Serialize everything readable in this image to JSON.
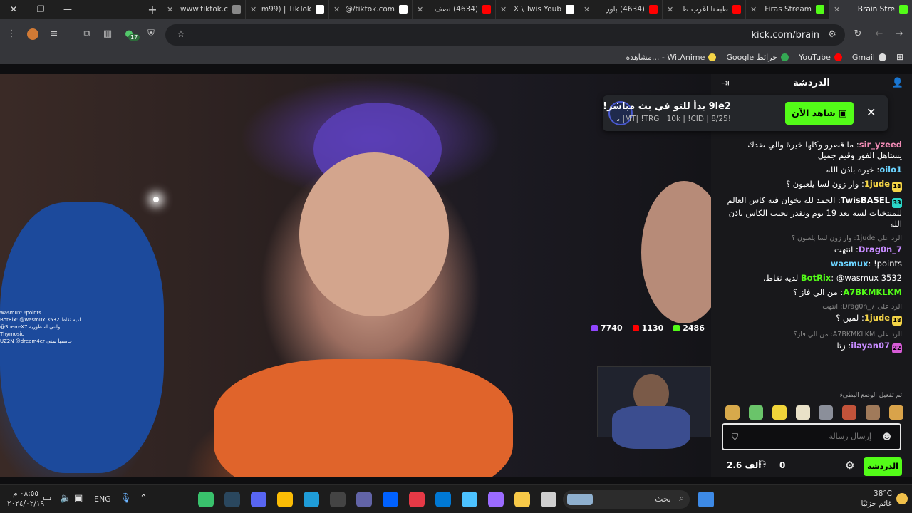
{
  "tabs": [
    {
      "title": "Brain Stre",
      "active": true,
      "favicon_color": "#53fc18"
    },
    {
      "title": "Firas Stream",
      "active": false,
      "favicon_color": "#53fc18"
    },
    {
      "title": "طبخنا اغرب ط",
      "active": false,
      "favicon_color": "#ff0000"
    },
    {
      "title": "(4634) باور",
      "active": false,
      "favicon_color": "#ff0000"
    },
    {
      "title": "X \\ Twis Youb",
      "active": false,
      "favicon_color": "#ffffff"
    },
    {
      "title": "(4634) نصف",
      "active": false,
      "favicon_color": "#ff0000"
    },
    {
      "title": "tiktok.com/@",
      "active": false,
      "favicon_color": "#ffffff"
    },
    {
      "title": "m99) | TikTok",
      "active": false,
      "favicon_color": "#ffffff"
    },
    {
      "title": "www.tiktok.c",
      "active": false,
      "favicon_color": "#888888"
    }
  ],
  "address": {
    "url": "kick.com/brain"
  },
  "extensions": {
    "badge_count": "17"
  },
  "bookmarks": [
    {
      "label": "Gmail",
      "color": "#dddddd"
    },
    {
      "label": "YouTube",
      "color": "#ff0000"
    },
    {
      "label": "Google خرائط",
      "color": "#34a853"
    },
    {
      "label": "مشاهدة... - WitAnime",
      "color": "#f5d547"
    }
  ],
  "video": {
    "stats": [
      {
        "icon": "eye-icon",
        "value": "2486",
        "color": "#53fc18"
      },
      {
        "icon": "youtube-icon",
        "value": "1130",
        "color": "#ff0000"
      },
      {
        "icon": "twitch-icon",
        "value": "7740",
        "color": "#9146ff"
      }
    ],
    "overlay_chat": [
      "wasmux: !points",
      "BotRix: @wasmux 3532 لديه نقاط",
      "@Shem-X7 وانتي اسطوريه",
      "Thymosic",
      "UZ2N @dream4er حاسيها بمني"
    ]
  },
  "chat": {
    "title": "الدردشة",
    "notification": {
      "title": "9le2 بدأ للتو في بث مباشر!",
      "subtitle": "!MT| !TRG | 10k | !CID | 8/25| تشوفيه...",
      "button": "شاهد الآن"
    },
    "messages": [
      {
        "type": "msg",
        "user": "sir_yzeed",
        "color": "#f08bb5",
        "text": "ما قصرو وكلها خيرة والي ضدك يستاهل الفوز وقيم جميل"
      },
      {
        "type": "msg",
        "user": "oilo1",
        "color": "#6cd4ff",
        "text": "خيره باذن الله"
      },
      {
        "type": "msg",
        "user": "1jude",
        "color": "#f5d547",
        "badge": "18",
        "badge_color": "#f5d547",
        "text": "وار زون لسا يلعبون ؟"
      },
      {
        "type": "msg",
        "user": "TwisBASEL",
        "color": "#ffffff",
        "badge": "33",
        "badge_color": "#2bd6c8",
        "text": "الحمد لله يخوان فيه كاس العالم للمنتخبات لسه بعد 19 يوم ونقدر نجيب الكاس باذن الله"
      },
      {
        "type": "reply",
        "text": "الرد على 1jude: وار زون لسا يلعبون ؟"
      },
      {
        "type": "msg",
        "user": "7_Drag0n",
        "color": "#c78bff",
        "text": "انتهت"
      },
      {
        "type": "msg",
        "user": "wasmux",
        "color": "#6cd4ff",
        "text": "!points"
      },
      {
        "type": "msg",
        "user": "BotRix",
        "color": "#53fc18",
        "text": "@wasmux 3532 لديه نقاط."
      },
      {
        "type": "msg",
        "user": "A7BKMKLKM",
        "color": "#53fc18",
        "text": "من الي فاز ؟"
      },
      {
        "type": "reply",
        "text": "الرد على 7_Drag0n: انتهت"
      },
      {
        "type": "msg",
        "user": "1jude",
        "color": "#f5d547",
        "badge": "18",
        "badge_color": "#f5d547",
        "text": "لمين ؟"
      },
      {
        "type": "reply",
        "text": "الرد على A7BKMKLKM: من الي فاز؟"
      },
      {
        "type": "msg",
        "user": "ilayan07",
        "color": "#c78bff",
        "badge": "22",
        "badge_color": "#d65bd6",
        "text": "زتا"
      }
    ],
    "pinned_note": "تم تفعيل الوضع البطيء",
    "input_placeholder": "إرسال رسالة",
    "followers": "2.6 ألف",
    "points": "0",
    "send_label": "الدردشة"
  },
  "taskbar": {
    "search_placeholder": "بحث",
    "weather_temp": "38°C",
    "weather_desc": "غائم جزئيًا",
    "time": "٠٨:٥٥ م",
    "date": "٢٠٢٤/٠٢/١٩",
    "lang": "ENG",
    "apps": [
      {
        "name": "xbox-app-icon",
        "color": "#39c16c"
      },
      {
        "name": "steam-app-icon",
        "color": "#2a475e"
      },
      {
        "name": "discord-app-icon",
        "color": "#5865f2"
      },
      {
        "name": "chrome-app-icon",
        "color": "#fbbc05"
      },
      {
        "name": "edge-app-icon",
        "color": "#1f9cd8"
      },
      {
        "name": "epic-games-app-icon",
        "color": "#444444"
      },
      {
        "name": "teams-app-icon",
        "color": "#6264a7"
      },
      {
        "name": "dropbox-app-icon",
        "color": "#0061ff"
      },
      {
        "name": "red-app-icon",
        "color": "#e63946"
      },
      {
        "name": "mail-app-icon",
        "color": "#0078d4"
      },
      {
        "name": "store-app-icon",
        "color": "#4cc2ff"
      },
      {
        "name": "copilot-app-icon",
        "color": "#9b6bff"
      },
      {
        "name": "file-explorer-app-icon",
        "color": "#f7c948"
      },
      {
        "name": "blank-app-icon",
        "color": "#cfcfcf"
      }
    ]
  }
}
